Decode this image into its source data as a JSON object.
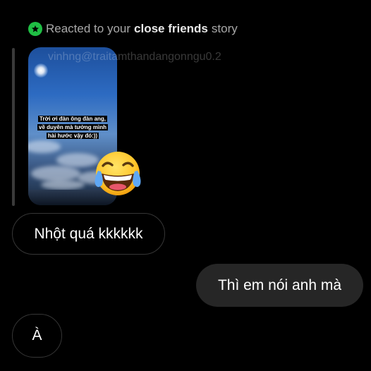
{
  "reply_context": {
    "prefix": "Reacted to your",
    "emphasis": "close friends",
    "suffix": "story",
    "badge_icon": "star-icon",
    "badge_color": "#1fbe44"
  },
  "story": {
    "username": "vinhng@traitamthandangonngu0.2",
    "caption_lines": [
      "Trời ơi đàn ông đàn ang,",
      "về duyên mà tưởng mình",
      "hài hước vậy đó:))"
    ],
    "reaction_emoji": "face-with-tears-of-joy"
  },
  "messages": [
    {
      "sender": "them",
      "text": "Nhột quá kkkkkk"
    },
    {
      "sender": "me",
      "text": "Thì em nói anh mà"
    },
    {
      "sender": "them",
      "text": "À"
    }
  ],
  "colors": {
    "background": "#000000",
    "sent_bubble": "#262626",
    "received_border": "#363636"
  }
}
